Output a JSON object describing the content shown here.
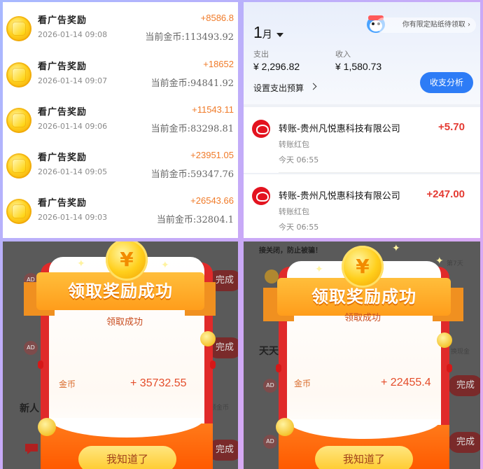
{
  "coin_list": {
    "rows": [
      {
        "title": "看广告奖励",
        "time": "2026-01-14 09:08",
        "amount": "+8586.8",
        "balance": "当前金币:113493.92"
      },
      {
        "title": "看广告奖励",
        "time": "2026-01-14 09:07",
        "amount": "+18652",
        "balance": "当前金币:94841.92"
      },
      {
        "title": "看广告奖励",
        "time": "2026-01-14 09:06",
        "amount": "+11543.11",
        "balance": "当前金币:83298.81"
      },
      {
        "title": "看广告奖励",
        "time": "2026-01-14 09:05",
        "amount": "+23951.05",
        "balance": "当前金币:59347.76"
      },
      {
        "title": "看广告奖励",
        "time": "2026-01-14 09:03",
        "amount": "+26543.66",
        "balance": "当前金币:32804.1"
      }
    ]
  },
  "bill": {
    "month": "1",
    "month_unit": "月",
    "promo": "你有限定贴纸待领取",
    "expense_label": "支出",
    "expense_value": "¥ 2,296.82",
    "income_label": "收入",
    "income_value": "¥ 1,580.73",
    "budget_label": "设置支出预算",
    "analysis_button": "收支分析",
    "transactions": [
      {
        "title": "转账-贵州凡悦惠科技有限公司",
        "amount": "+5.70",
        "subtitle": "转账红包",
        "time": "今天 06:55"
      },
      {
        "title": "转账-贵州凡悦惠科技有限公司",
        "amount": "+247.00",
        "subtitle": "转账红包",
        "time": "今天 06:55"
      }
    ]
  },
  "dialog_left": {
    "coin_symbol": "¥",
    "ribbon": "领取奖励成功",
    "status": "领取成功",
    "currency_label": "金币",
    "value": "+ 35732.55",
    "confirm_button": "我知道了",
    "bg_complete_1": "完成",
    "bg_complete_2": "完成",
    "bg_complete_3": "完成",
    "bg_ad": "AD",
    "bg_new": "新人",
    "bg_coins": "领金币"
  },
  "dialog_right": {
    "coin_symbol": "¥",
    "ribbon": "领取奖励成功",
    "status": "领取成功",
    "currency_label": "金币",
    "value": "+ 22455.4",
    "confirm_button": "我知道了",
    "bg_notice": "接关闭，防止被骗！",
    "bg_day": "第7天",
    "bg_daily": "天天",
    "bg_cash": "换现金",
    "bg_complete_1": "完成",
    "bg_complete_2": "完成",
    "bg_ad": "AD"
  },
  "colors": {
    "accent_orange": "#f07a28",
    "income_red": "#e43a32",
    "button_blue": "#2d7cf6",
    "dialog_red": "#e02a2a"
  }
}
